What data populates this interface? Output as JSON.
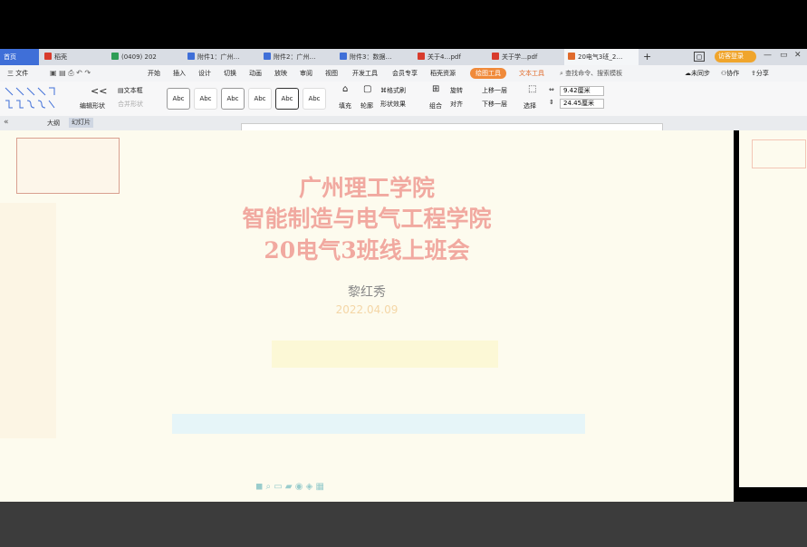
{
  "tabs": [
    {
      "label": "首页",
      "color": "#3f6fd8"
    },
    {
      "label": "稻壳",
      "color": "#d83b2c"
    },
    {
      "label": "(0409) 202",
      "color": "#2e9d56"
    },
    {
      "label": "附件1：广州…",
      "color": "#3f6fd8"
    },
    {
      "label": "附件2：广州…",
      "color": "#3f6fd8"
    },
    {
      "label": "附件3：数据…",
      "color": "#3f6fd8"
    },
    {
      "label": "关于4…pdf",
      "color": "#d83b2c"
    },
    {
      "label": "关于学…pdf",
      "color": "#d83b2c"
    },
    {
      "label": "20电气3班_2…",
      "color": "#e06b2c"
    }
  ],
  "new_tab": "+",
  "login_label": "访客登录",
  "menu": {
    "file": "三 文件",
    "items": [
      "开始",
      "插入",
      "设计",
      "切换",
      "动画",
      "放映",
      "审阅",
      "视图",
      "开发工具",
      "会员专享",
      "稻壳资源"
    ],
    "drawing_tools": "绘图工具",
    "text_tools": "文本工具",
    "search": "查找命令、搜索模板",
    "sync": "未同步",
    "collab": "协作",
    "share": "分享"
  },
  "ribbon": {
    "textbox": "文本框",
    "edit_shape": "编辑形状",
    "merge_shape": "合并形状",
    "style_labels": [
      "Abc",
      "Abc",
      "Abc",
      "Abc",
      "Abc",
      "Abc"
    ],
    "fill": "填充",
    "outline": "轮廓",
    "format_painter": "格式刷",
    "shape_effect": "形状效果",
    "group": "组合",
    "rotate": "旋转",
    "align": "对齐",
    "bring_forward": "上移一层",
    "send_backward": "下移一层",
    "select": "选择",
    "width": "9.42厘米",
    "height": "24.45厘米"
  },
  "panel_tabs": [
    "大纲",
    "幻灯片"
  ],
  "slide": {
    "line1": "广州理工学院",
    "line2": "智能制造与电气工程学院",
    "line3": "20电气3班线上班会",
    "presenter": "黎红秀",
    "date": "2022.04.09"
  },
  "colors": {
    "title": "#f1a9a0",
    "slide_bg": "#fdfbee",
    "accent": "#3f6fd8",
    "drawing_tools": "#f08a3a"
  }
}
